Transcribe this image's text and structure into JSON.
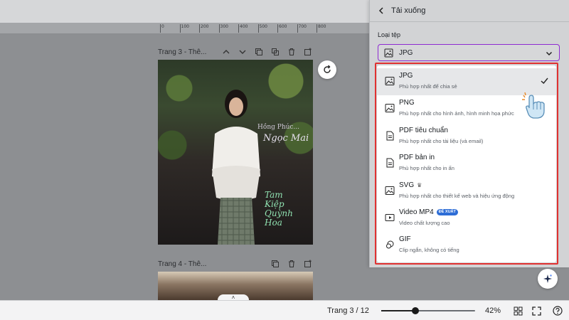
{
  "ruler": {
    "ticks": [
      "0",
      "100",
      "200",
      "300",
      "400",
      "500",
      "600",
      "700",
      "800"
    ]
  },
  "pages": [
    {
      "label": "Trang 3 - Thê..."
    },
    {
      "label": "Trang 4 - Thê..."
    }
  ],
  "page_toolbar_icons": [
    "chevron-up-icon",
    "chevron-down-icon",
    "duplicate-icon",
    "copy-icon",
    "trash-icon",
    "add-page-icon"
  ],
  "artwork": {
    "line1": "Hồng Phúc...",
    "line2": "Ngọc Mai",
    "line3": [
      "Tam",
      "Kiệp",
      "Quỳnh",
      "Hoa"
    ]
  },
  "panel": {
    "title": "Tải xuống",
    "filetype_label": "Loại tệp",
    "selected_value": "JPG"
  },
  "file_options": [
    {
      "name": "JPG",
      "desc": "Phù hợp nhất để chia sẻ",
      "selected": true,
      "icon": "image-icon"
    },
    {
      "name": "PNG",
      "desc": "Phù hợp nhất cho hình ảnh, hình minh họa phức",
      "selected": false,
      "icon": "image-icon"
    },
    {
      "name": "PDF tiêu chuẩn",
      "desc": "Phù hợp nhất cho tài liệu (và email)",
      "selected": false,
      "icon": "document-icon"
    },
    {
      "name": "PDF bản in",
      "desc": "Phù hợp nhất cho in ấn",
      "selected": false,
      "icon": "document-icon"
    },
    {
      "name": "SVG",
      "desc": "Phù hợp nhất cho thiết kế web và hiệu ứng động",
      "selected": false,
      "icon": "image-icon",
      "crown": "♛"
    },
    {
      "name": "Video MP4",
      "desc": "Video chất lượng cao",
      "selected": false,
      "icon": "video-icon",
      "badge": "ĐỀ XUẤT"
    },
    {
      "name": "GIF",
      "desc": "Clip ngắn, không có tiếng",
      "selected": false,
      "icon": "gif-icon"
    }
  ],
  "bottombar": {
    "page_indicator": "Trang 3 / 12",
    "zoom_label": "42%",
    "zoom_fraction": 0.36,
    "collapse": "˄"
  },
  "colors": {
    "accent": "#8e2ad1",
    "highlight_border": "#e03131",
    "badge": "#2d6dd6"
  }
}
